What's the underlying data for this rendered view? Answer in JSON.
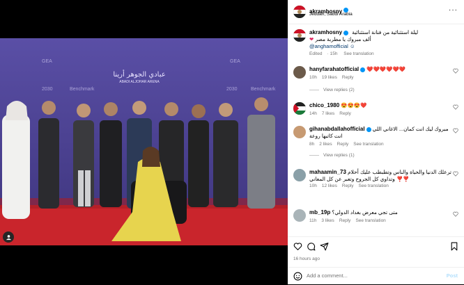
{
  "post": {
    "username": "akramhosny",
    "location": "Jeddah, Saudi Arabia",
    "more_icon": "ellipsis-icon",
    "time_ago": "16 hours ago"
  },
  "caption": {
    "username": "akramhosny",
    "line1": "ليلة استثنائية من فنانة استثنائية",
    "line2": "ألف مبروك يا مطربة مصر",
    "mention": "anghamofficial",
    "edited": "Edited",
    "time": "15h",
    "see_translation": "See translation"
  },
  "photo": {
    "backdrop_title_ar": "عبادي الجوهر أرينا",
    "backdrop_title_en": "ABADI ALJOHAR ARENA",
    "sponsor1": "Benchmark",
    "sponsor2": "2030",
    "sponsor3": "GEA"
  },
  "comments": [
    {
      "username": "hanyfarahatofficial",
      "text": "❤️❤️❤️❤️❤️❤️",
      "time": "10h",
      "likes": "19 likes",
      "reply": "Reply",
      "view_replies": "View replies (2)"
    },
    {
      "username": "chico_1980",
      "text": "😍😍😍❤️",
      "time": "14h",
      "likes": "7 likes",
      "reply": "Reply"
    },
    {
      "username": "gihanabdallahofficial",
      "text": "مبروك ليك انت كمان... الاغاني اللي انت كاتبها روعة",
      "time": "8h",
      "likes": "2 likes",
      "reply": "Reply",
      "see_translation": "See translation",
      "view_replies": "View replies (1)"
    },
    {
      "username": "mahaamin_73",
      "text": "ترعلك الدنيا والحياة والناس وتطبطب عليك أحلام وتداوي كل الجروح وتعبر عن كل المعاني ❣️❣️",
      "time": "10h",
      "likes": "12 likes",
      "reply": "Reply",
      "see_translation": "See translation"
    },
    {
      "username": "mb_19p",
      "text": "متى تجي معرض بغداد الدولي؟",
      "time": "11h",
      "likes": "3 likes",
      "reply": "Reply",
      "see_translation": "See translation"
    }
  ],
  "actions": {
    "time_ago": "16 hours ago"
  },
  "add_comment": {
    "placeholder": "Add a comment...",
    "post_label": "Post"
  }
}
